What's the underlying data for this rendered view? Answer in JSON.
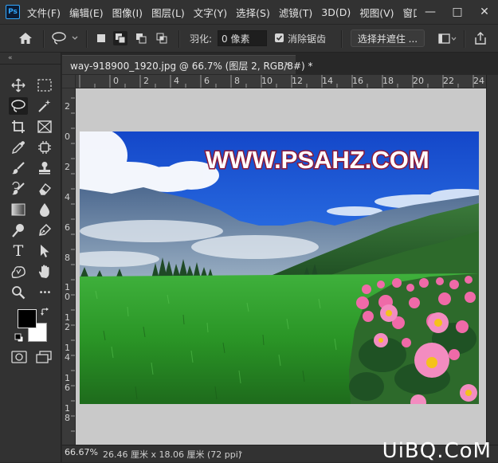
{
  "app": {
    "logo": "Ps"
  },
  "menu": [
    "文件(F)",
    "编辑(E)",
    "图像(I)",
    "图层(L)",
    "文字(Y)",
    "选择(S)",
    "滤镜(T)",
    "3D(D)",
    "视图(V)",
    "窗口(W"
  ],
  "window_controls": [
    "—",
    "□",
    "✕"
  ],
  "options": {
    "feather_label": "羽化:",
    "feather_value": "0 像素",
    "antialias_label": "消除锯齿",
    "antialias_checked": true,
    "select_mask_button": "选择并遮住 ..."
  },
  "toolbox": {
    "collapse": "«",
    "tools": [
      "move-tool",
      "marquee-tool",
      "lasso-tool",
      "magic-wand-tool",
      "crop-tool",
      "frame-tool",
      "eyedropper-tool",
      "spot-healing-tool",
      "brush-tool",
      "stamp-tool",
      "history-brush-tool",
      "eraser-tool",
      "gradient-tool",
      "blur-tool",
      "dodge-tool",
      "pen-tool",
      "type-tool",
      "path-selection-tool",
      "shape-tool",
      "hand-tool",
      "zoom-tool",
      "more-tools"
    ],
    "active_tool": "lasso-tool",
    "type_glyph": "T",
    "more_glyph": "•••",
    "foreground_color": "#000000",
    "background_color": "#ffffff"
  },
  "document": {
    "tab_title": "way-918900_1920.jpg @ 66.7% (图层 2, RGB/8#) *",
    "tab_close": "×",
    "image_text": "WWW.PSAHZ.COM"
  },
  "rulers": {
    "horizontal": [
      "0",
      "2",
      "4",
      "6",
      "8",
      "10",
      "12",
      "14",
      "16",
      "18",
      "20",
      "22",
      "24",
      "26"
    ],
    "vertical": [
      "2",
      "0",
      "2",
      "4",
      "6",
      "8",
      "1\n0",
      "1\n2",
      "1\n4",
      "1\n6",
      "1\n8"
    ]
  },
  "status": {
    "zoom": "66.67%",
    "doc_info": "26.46 厘米 x 18.06 厘米 (72 ppi)",
    "arrow": "›"
  },
  "watermark": "UiBQ.CoM"
}
